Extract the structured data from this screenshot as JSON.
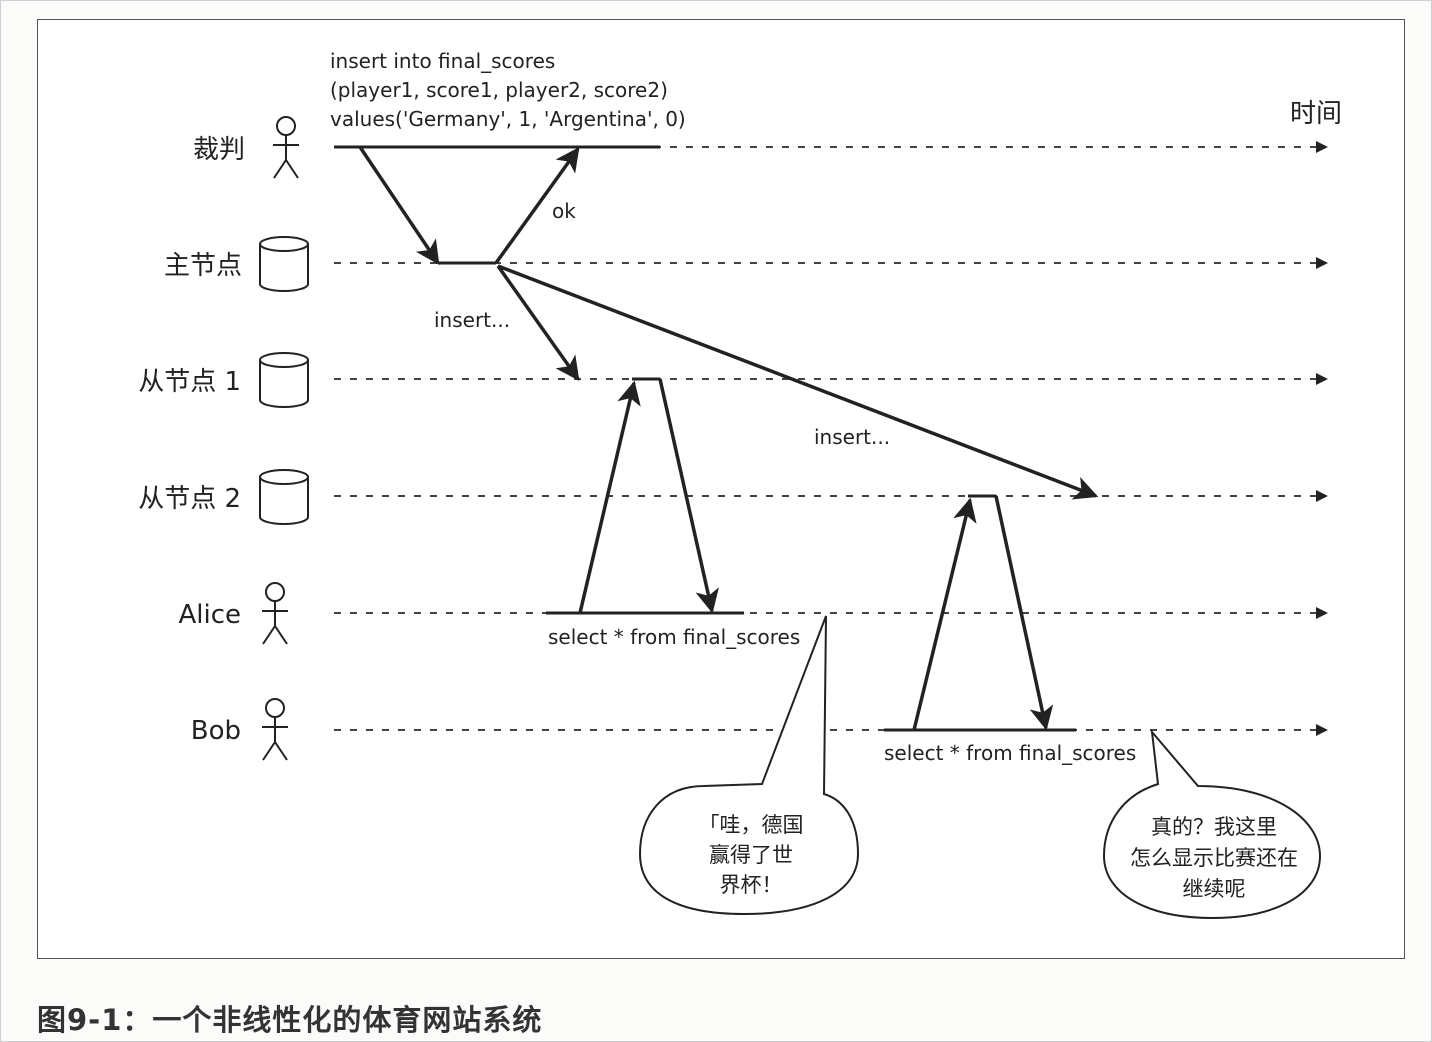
{
  "timeline_label": "时间",
  "participants": [
    {
      "label": "裁判",
      "icon": "stick-figure-icon"
    },
    {
      "label": "主节点",
      "icon": "database-cylinder-icon"
    },
    {
      "label": "从节点 1",
      "icon": "database-cylinder-icon"
    },
    {
      "label": "从节点 2",
      "icon": "database-cylinder-icon"
    },
    {
      "label": "Alice",
      "icon": "stick-figure-icon"
    },
    {
      "label": "Bob",
      "icon": "stick-figure-icon"
    }
  ],
  "insert_statement": [
    "insert into final_scores",
    "(player1, score1, player2, score2)",
    "values('Germany', 1, 'Argentina', 0)"
  ],
  "messages": {
    "ok": "ok",
    "insert_to_follower1": "insert...",
    "insert_to_follower2": "insert...",
    "alice_query": "select * from final_scores",
    "bob_query": "select * from final_scores"
  },
  "speech": {
    "alice": [
      "「哇，德国",
      "赢得了世",
      "界杯！"
    ],
    "bob": [
      "真的？我这里",
      "怎么显示比赛还在",
      "继续呢"
    ]
  },
  "caption": "图9-1：一个非线性化的体育网站系统",
  "colors": {
    "ink": "#222222",
    "frame": "#555555",
    "background": "#ffffff"
  }
}
